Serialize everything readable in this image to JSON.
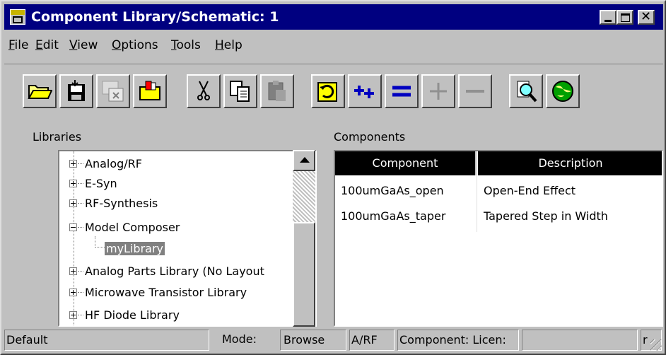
{
  "window": {
    "title": "Component Library/Schematic: 1",
    "app_icon": "ads-app-icon",
    "controls": [
      "minimize-icon",
      "maximize-icon",
      "close-icon"
    ]
  },
  "menu": {
    "items": [
      {
        "u": "F",
        "rest": "ile"
      },
      {
        "u": "E",
        "rest": "dit"
      },
      {
        "u": "V",
        "rest": "iew"
      },
      {
        "u": "O",
        "rest": "ptions"
      },
      {
        "u": "T",
        "rest": "ools"
      },
      {
        "u": "H",
        "rest": "elp"
      }
    ]
  },
  "toolbar": {
    "buttons": [
      {
        "name": "open-folder-icon",
        "enabled": true
      },
      {
        "name": "save-disk-icon",
        "enabled": true
      },
      {
        "name": "close-window-icon",
        "enabled": false
      },
      {
        "name": "library-folder-icon",
        "enabled": true
      },
      {
        "name": "cut-scissors-icon",
        "enabled": true
      },
      {
        "name": "copy-icon",
        "enabled": true
      },
      {
        "name": "paste-clipboard-icon",
        "enabled": false
      },
      {
        "name": "refresh-icon",
        "enabled": true
      },
      {
        "name": "add-plus-icon",
        "enabled": true
      },
      {
        "name": "equal-icon",
        "enabled": true
      },
      {
        "name": "plus-icon",
        "enabled": false
      },
      {
        "name": "minus-icon",
        "enabled": false
      },
      {
        "name": "search-magnifier-icon",
        "enabled": true
      },
      {
        "name": "globe-icon",
        "enabled": true
      }
    ]
  },
  "libraries": {
    "label": "Libraries",
    "items": [
      {
        "label": "Analog/RF",
        "expanded": false
      },
      {
        "label": "E-Syn",
        "expanded": false
      },
      {
        "label": "RF-Synthesis",
        "expanded": false
      },
      {
        "label": "Model Composer",
        "expanded": true
      },
      {
        "label": "myLibrary",
        "child": true,
        "selected": true
      },
      {
        "label": "Analog Parts Library (No Layout",
        "expanded": false
      },
      {
        "label": "Microwave Transistor Library",
        "expanded": false
      },
      {
        "label": "HF Diode Library",
        "expanded": false
      }
    ]
  },
  "components": {
    "label": "Components",
    "columns": [
      "Component",
      "Description"
    ],
    "rows": [
      [
        "100umGaAs_open",
        "Open-End Effect"
      ],
      [
        "100umGaAs_taper",
        "Tapered Step in Width"
      ]
    ]
  },
  "status": {
    "default": "Default",
    "mode_label": "Mode:",
    "mode_value": "Browse",
    "domain": "A/RF",
    "component_license": "Component: Licen:",
    "empty": "",
    "last": "r"
  },
  "colors": {
    "title_bar": "#000080",
    "face": "#c0c0c0",
    "header": "#000000",
    "selection": "#808080"
  }
}
